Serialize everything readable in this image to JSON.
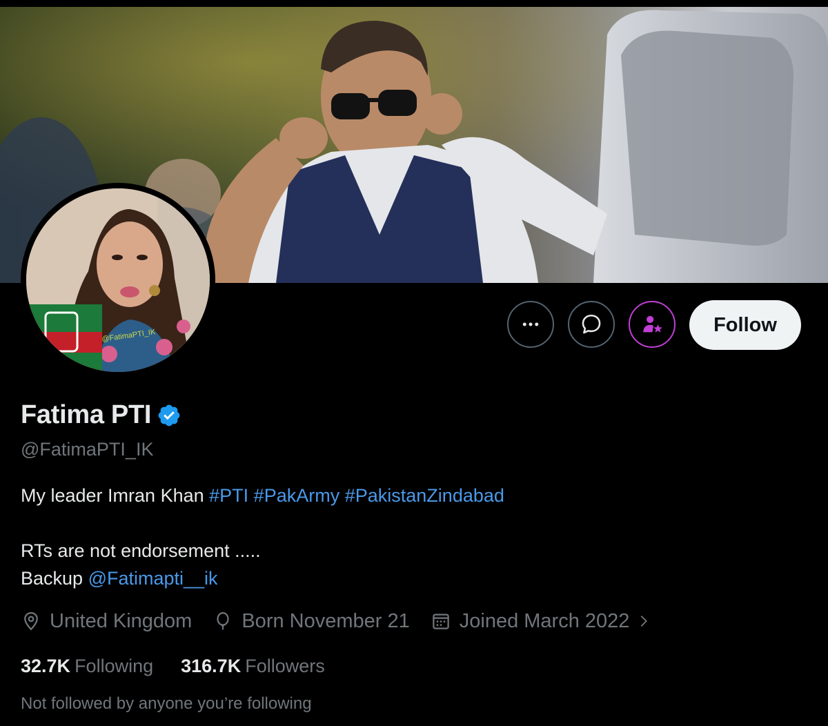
{
  "profile": {
    "display_name": "Fatima PTI",
    "handle": "@FatimaPTI_IK",
    "verified": true,
    "bio": {
      "line1_text": "My leader Imran Khan ",
      "hashtags": [
        "#PTI",
        "#PakArmy",
        "#PakistanZindabad"
      ],
      "line2": "RTs are not endorsement .....",
      "line3_text": "Backup ",
      "line3_mention": "@Fatimapti__ik"
    },
    "meta": {
      "location": "United Kingdom",
      "birthday": "Born November 21",
      "joined": "Joined March 2022"
    },
    "stats": {
      "following_count": "32.7K",
      "following_label": "Following",
      "followers_count": "316.7K",
      "followers_label": "Followers"
    },
    "not_followed_note": "Not followed by anyone you’re following",
    "avatar_watermark": "@FatimaPTI_IK"
  },
  "actions": {
    "more_icon": "more-icon",
    "message_icon": "message-icon",
    "subscribe_icon": "subscribe-icon",
    "follow_label": "Follow"
  },
  "colors": {
    "background": "#000000",
    "text_primary": "#e7e9ea",
    "text_secondary": "#71767b",
    "link": "#4a99e9",
    "verified": "#1d9bf0",
    "subscribe_accent": "#c03fd6",
    "follow_bg": "#eff3f4"
  }
}
